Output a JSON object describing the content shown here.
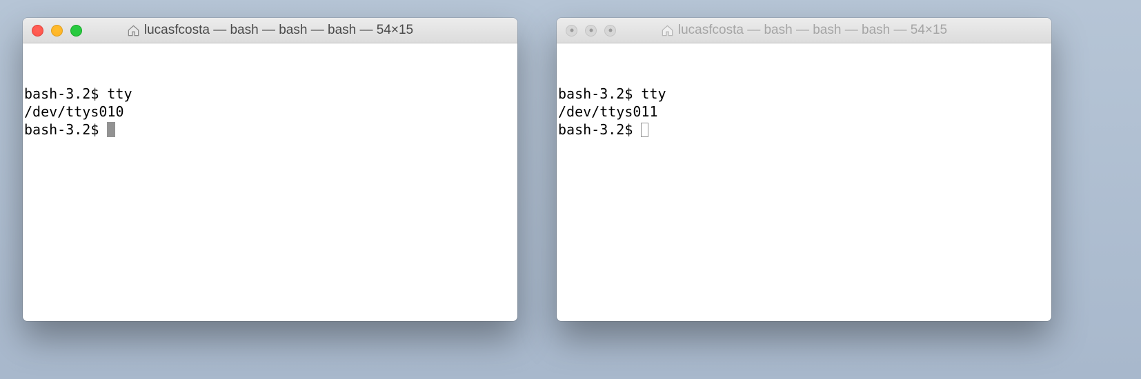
{
  "windows": [
    {
      "state": "active",
      "title": "lucasfcosta — bash — bash — bash — 54×15",
      "terminal": {
        "line1_prompt": "bash-3.2$ ",
        "line1_command": "tty",
        "line2_output": "/dev/ttys010",
        "line3_prompt": "bash-3.2$ "
      },
      "cursor_style": "block"
    },
    {
      "state": "inactive",
      "title": "lucasfcosta — bash — bash — bash — 54×15",
      "terminal": {
        "line1_prompt": "bash-3.2$ ",
        "line1_command": "tty",
        "line2_output": "/dev/ttys011",
        "line3_prompt": "bash-3.2$ "
      },
      "cursor_style": "outline"
    }
  ]
}
